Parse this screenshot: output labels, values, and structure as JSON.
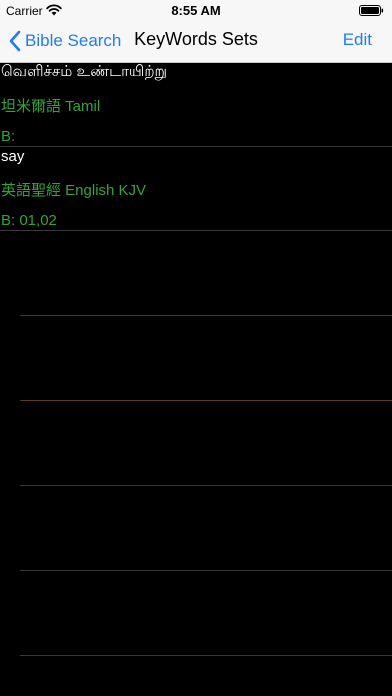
{
  "status_bar": {
    "carrier": "Carrier",
    "time": "8:55 AM",
    "wifi_icon": "wifi-icon",
    "battery_icon": "battery-icon"
  },
  "nav": {
    "back_label": "Bible Search",
    "title": "KeyWords Sets",
    "edit_label": "Edit",
    "back_icon": "chevron-left-icon",
    "accent_color": "#1f7cf5"
  },
  "sets": [
    {
      "keywords": "வெளிச்சம் உண்டாயிற்று",
      "language": "坦米爾語 Tamil",
      "books": "B:"
    },
    {
      "keywords": "say",
      "language": "英語聖經 English KJV",
      "books": "B: 01,02"
    }
  ],
  "colors": {
    "background": "#000000",
    "keyword_text": "#ffffff",
    "meta_text": "#35a33a",
    "chrome": "#f7f7f7"
  }
}
